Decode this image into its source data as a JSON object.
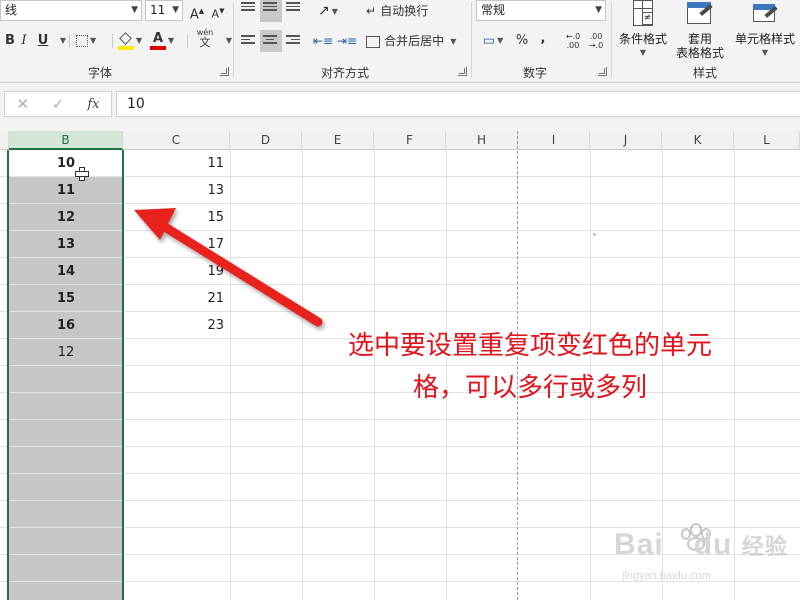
{
  "ribbon": {
    "font_name_partial": "线",
    "font_size": "11",
    "grow_font": "A",
    "shrink_font": "A",
    "wen_char": "wén",
    "wen_label": "文",
    "bold": "B",
    "italic": "I",
    "underline": "U",
    "font_color_letter": "A",
    "wrap_text_label": "自动换行",
    "merge_center_label": "合并后居中",
    "number_format": "常规",
    "percent": "%",
    "comma": ",",
    "inc_decimal": "←.0 .00",
    "dec_decimal": ".00 →.0",
    "conditional_format_label": "条件格式",
    "table_format_line1": "套用",
    "table_format_line2": "表格格式",
    "cell_styles_label": "单元格样式",
    "group_font": "字体",
    "group_alignment": "对齐方式",
    "group_number": "数字",
    "group_styles": "样式"
  },
  "formula_bar": {
    "cancel": "✕",
    "confirm": "✓",
    "fx": "fx",
    "value": "10"
  },
  "columns": [
    "B",
    "C",
    "D",
    "E",
    "F",
    "H",
    "I",
    "J",
    "K",
    "L"
  ],
  "column_b_values": [
    "10",
    "11",
    "12",
    "13",
    "14",
    "15",
    "16",
    "12"
  ],
  "column_c_values": [
    "11",
    "13",
    "15",
    "17",
    "19",
    "21",
    "23"
  ],
  "stray_mark": "`",
  "annotation": {
    "line1": "选中要设置重复项变红色的单元",
    "line2": "格，可以多行或多列"
  },
  "colors": {
    "selection_green": "#217346",
    "annotation_red": "#e0141b",
    "selection_fill": "#c6c6c6"
  },
  "watermark": {
    "brand": "Bai",
    "brand2": "du",
    "brand_cn": "经验",
    "url": "jingyan.baidu.com"
  }
}
